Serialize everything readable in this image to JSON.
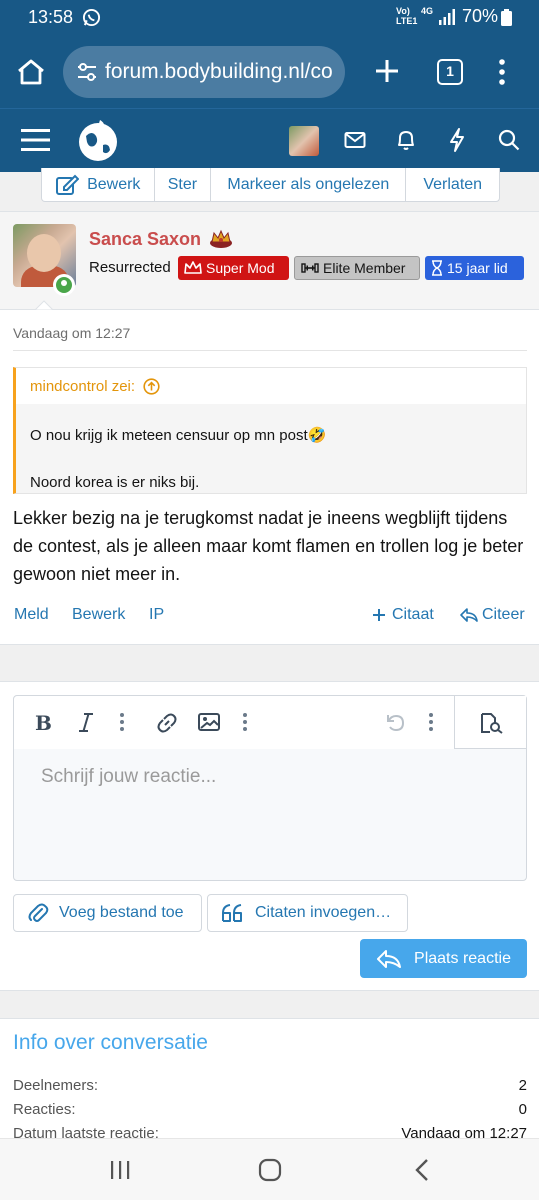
{
  "status_bar": {
    "time": "13:58",
    "network_top": "Vo)",
    "network_bottom": "LTE1",
    "network_type": "4G",
    "battery": "70%"
  },
  "browser": {
    "url": "forum.bodybuilding.nl/co",
    "tab_count": "1"
  },
  "thread_actions": [
    "Bewerk",
    "Ster",
    "Markeer als ongelezen",
    "Verlaten"
  ],
  "message": {
    "username": "Sanca Saxon",
    "user_rank": "Resurrected",
    "badges": {
      "super_mod": "Super Mod",
      "elite": "Elite Member",
      "years": "15 jaar lid"
    },
    "date": "Vandaag om 12:27",
    "quote": {
      "author_line": "mindcontrol zei:",
      "line1": "O nou krijg ik meteen censuur op mn post🤣",
      "line2": "Noord korea is er niks bij."
    },
    "body": "Lekker bezig na je terugkomst nadat je ineens wegblijft tijdens de contest, als je alleen maar komt flamen en trollen log je beter gewoon niet meer in.",
    "links": {
      "report": "Meld",
      "edit": "Bewerk",
      "ip": "IP",
      "multiquote": "Citaat",
      "reply": "Citeer"
    }
  },
  "reply": {
    "placeholder": "Schrijf jouw reactie...",
    "attach_label": "Voeg bestand toe",
    "insert_quotes_label": "Citaten invoegen…",
    "submit_label": "Plaats reactie"
  },
  "info": {
    "title": "Info over conversatie",
    "rows": [
      {
        "label": "Deelnemers:",
        "value": "2"
      },
      {
        "label": "Reacties:",
        "value": "0"
      },
      {
        "label": "Datum laatste reactie:",
        "value": "Vandaag om 12:27"
      }
    ]
  },
  "colors": {
    "brand_header": "#185886",
    "link": "#2577b1",
    "username": "#c94d4d",
    "quote_accent": "#f7a21d",
    "submit": "#47a7eb",
    "super_mod_badge": "#d01414",
    "years_badge": "#2b62dc"
  }
}
